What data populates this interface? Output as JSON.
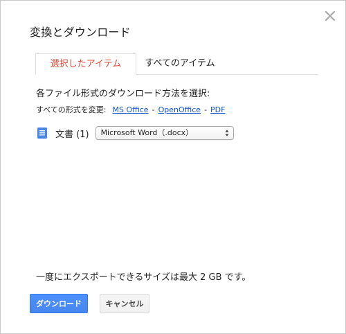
{
  "dialog": {
    "title": "変換とダウンロード",
    "close_icon": "close-icon"
  },
  "tabs": [
    {
      "label": "選択したアイテム",
      "active": true
    },
    {
      "label": "すべてのアイテム",
      "active": false
    }
  ],
  "content": {
    "heading": "各ファイル形式のダウンロード方法を選択:",
    "change_all_label": "すべての形式を変更:",
    "format_links": [
      "MS Office",
      "OpenOffice",
      "PDF"
    ],
    "separator": "-",
    "doc_type_label": "文書 (1)",
    "doc_icon": "document-icon",
    "selected_format": "Microsoft Word（.docx）"
  },
  "footer": {
    "size_note": "一度にエクスポートできるサイズは最大 2 GB です。",
    "download_label": "ダウンロード",
    "cancel_label": "キャンセル"
  },
  "colors": {
    "active_tab_text": "#dd4b39",
    "link": "#1155cc",
    "primary_button": "#4d90fe",
    "doc_icon": "#4a86e8"
  }
}
